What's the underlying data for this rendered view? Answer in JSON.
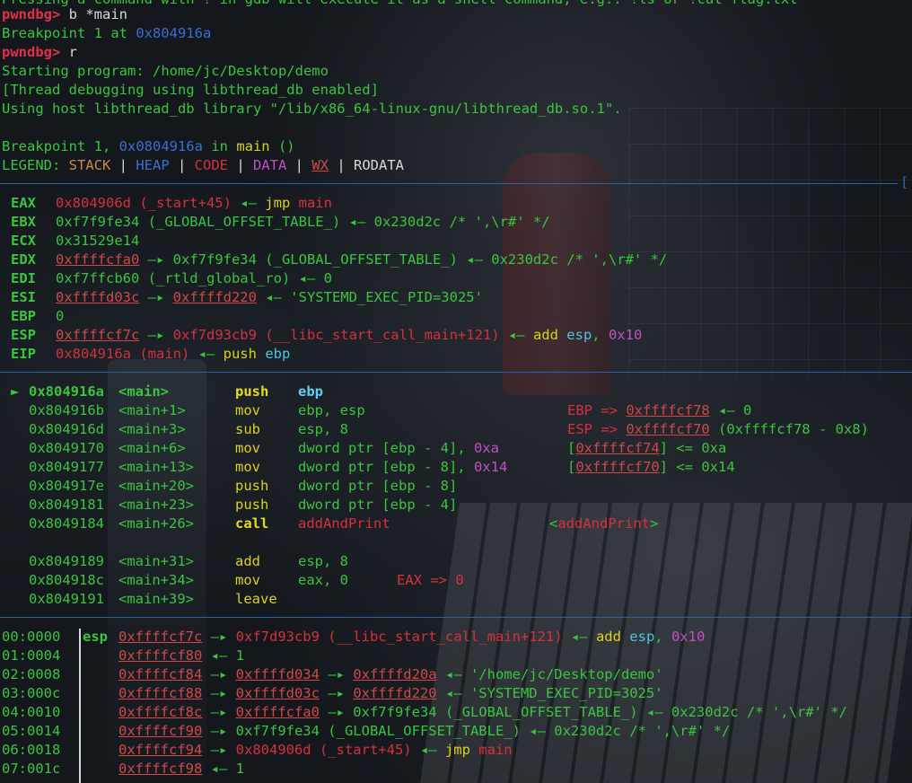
{
  "prompt": "pwndbg>",
  "session": [
    [
      "Pressing a command with ! in gdb will execute it as a shell command, e.g.: !ls or !cat flag.txt"
    ],
    [
      "b *main"
    ],
    [
      "Breakpoint 1 at ",
      "0x804916a"
    ],
    [
      "r"
    ],
    [
      "Starting program: ",
      "/home/jc/Desktop/demo"
    ],
    [
      "[Thread debugging using libthread_db enabled]"
    ],
    [
      "Using host libthread_db library \"/lib/x86_64-linux-gnu/libthread_db.so.1\"."
    ],
    [
      "Breakpoint 1, ",
      "0x0804916a",
      " in ",
      "main",
      " ()"
    ]
  ],
  "legend": {
    "label": "LEGEND:",
    "items": [
      "STACK",
      "HEAP",
      "CODE",
      "DATA",
      "WX",
      "RODATA"
    ]
  },
  "registers_tag": "[",
  "registers": [
    {
      "name": "EAX",
      "parts": [
        [
          "0x804906d (_start+45)",
          "r"
        ],
        [
          " ◂— ",
          "g"
        ],
        [
          "jmp",
          "y"
        ],
        [
          " ",
          "g"
        ],
        [
          "main",
          "r"
        ]
      ]
    },
    {
      "name": "EBX",
      "parts": [
        [
          "0xf7f9fe34 (_GLOBAL_OFFSET_TABLE_)",
          "g"
        ],
        [
          " ◂— 0x230d2c /* ',\\r#' */",
          "g"
        ]
      ]
    },
    {
      "name": "ECX",
      "parts": [
        [
          "0x31529e14",
          "g"
        ]
      ]
    },
    {
      "name": "EDX",
      "parts": [
        [
          "0xffffcfa0",
          "wu"
        ],
        [
          " —▸ 0xf7f9fe34 (_GLOBAL_OFFSET_TABLE_) ◂— 0x230d2c /* ',\\r#' */",
          "g"
        ]
      ]
    },
    {
      "name": "EDI",
      "parts": [
        [
          "0xf7ffcb60 (_rtld_global_ro)",
          "g"
        ],
        [
          " ◂— 0",
          "g"
        ]
      ]
    },
    {
      "name": "ESI",
      "parts": [
        [
          "0xffffd03c",
          "wu"
        ],
        [
          " —▸ ",
          "g"
        ],
        [
          "0xffffd220",
          "wu"
        ],
        [
          " ◂— 'SYSTEMD_EXEC_PID=3025'",
          "g"
        ]
      ]
    },
    {
      "name": "EBP",
      "parts": [
        [
          "0",
          "g"
        ]
      ]
    },
    {
      "name": "ESP",
      "parts": [
        [
          "0xffffcf7c",
          "wu"
        ],
        [
          " —▸ ",
          "g"
        ],
        [
          "0xf7d93cb9 (__libc_start_call_main+121)",
          "r"
        ],
        [
          " ◂— ",
          "g"
        ],
        [
          "add",
          "y"
        ],
        [
          " ",
          "g"
        ],
        [
          "esp",
          "c"
        ],
        [
          ", ",
          "g"
        ],
        [
          "0x10",
          "m"
        ]
      ]
    },
    {
      "name": "EIP",
      "parts": [
        [
          "0x804916a (main)",
          "r"
        ],
        [
          " ◂— ",
          "g"
        ],
        [
          "push",
          "y"
        ],
        [
          " ",
          "g"
        ],
        [
          "ebp",
          "c"
        ]
      ]
    }
  ],
  "disasm": [
    {
      "marker": "►",
      "addr": "0x804916a",
      "sym": "<main>",
      "op": "push",
      "args": [
        [
          "ebp",
          "cb"
        ]
      ],
      "note": [],
      "current": true
    },
    {
      "marker": "",
      "addr": "0x804916b",
      "sym": "<main+1>",
      "op": "mov",
      "args": [
        [
          "ebp, esp",
          "g"
        ]
      ],
      "note": [
        [
          "EBP => ",
          "r"
        ],
        [
          "0xffffcf78",
          "wu"
        ],
        [
          " ◂— 0",
          "g"
        ]
      ]
    },
    {
      "marker": "",
      "addr": "0x804916d",
      "sym": "<main+3>",
      "op": "sub",
      "args": [
        [
          "esp, 8",
          "g"
        ]
      ],
      "note": [
        [
          "ESP => ",
          "r"
        ],
        [
          "0xffffcf70",
          "wu"
        ],
        [
          " (0xffffcf78 - 0x8)",
          "g"
        ]
      ]
    },
    {
      "marker": "",
      "addr": "0x8049170",
      "sym": "<main+6>",
      "op": "mov",
      "args": [
        [
          "dword ptr [ebp - 4], ",
          "g"
        ],
        [
          "0xa",
          "m"
        ]
      ],
      "note": [
        [
          "[",
          "g"
        ],
        [
          "0xffffcf74",
          "wu"
        ],
        [
          "] <= 0xa",
          "g"
        ]
      ]
    },
    {
      "marker": "",
      "addr": "0x8049177",
      "sym": "<main+13>",
      "op": "mov",
      "args": [
        [
          "dword ptr [ebp - 8], ",
          "g"
        ],
        [
          "0x14",
          "m"
        ]
      ],
      "note": [
        [
          "[",
          "g"
        ],
        [
          "0xffffcf70",
          "wu"
        ],
        [
          "] <= 0x14",
          "g"
        ]
      ]
    },
    {
      "marker": "",
      "addr": "0x804917e",
      "sym": "<main+20>",
      "op": "push",
      "args": [
        [
          "dword ptr [ebp - 8]",
          "g"
        ]
      ],
      "note": []
    },
    {
      "marker": "",
      "addr": "0x8049181",
      "sym": "<main+23>",
      "op": "push",
      "args": [
        [
          "dword ptr [ebp - 4]",
          "g"
        ]
      ],
      "note": []
    },
    {
      "marker": "",
      "addr": "0x8049184",
      "sym": "<main+26>",
      "op": "call",
      "args": [
        [
          "addAndPrint",
          "r"
        ]
      ],
      "note": [
        [
          "<",
          "g"
        ],
        [
          "addAndPrint",
          "r"
        ],
        [
          ">",
          "g"
        ]
      ],
      "call": true
    },
    {
      "blank": true
    },
    {
      "marker": "",
      "addr": "0x8049189",
      "sym": "<main+31>",
      "op": "add",
      "args": [
        [
          "esp, 8",
          "g"
        ]
      ],
      "note": []
    },
    {
      "marker": "",
      "addr": "0x804918c",
      "sym": "<main+34>",
      "op": "mov",
      "args": [
        [
          "eax, 0",
          "g"
        ]
      ],
      "note": [
        [
          "EAX => 0",
          "r"
        ]
      ],
      "near": true
    },
    {
      "marker": "",
      "addr": "0x8049191",
      "sym": "<main+39>",
      "op": "leave",
      "args": [],
      "note": []
    }
  ],
  "stack": [
    {
      "off": "00:0000",
      "reg": "esp",
      "parts": [
        [
          "0xffffcf7c",
          "wu"
        ],
        [
          " —▸ ",
          "g"
        ],
        [
          "0xf7d93cb9 (__libc_start_call_main+121)",
          "r"
        ],
        [
          " ◂— ",
          "g"
        ],
        [
          "add",
          "y"
        ],
        [
          " ",
          "g"
        ],
        [
          "esp",
          "c"
        ],
        [
          ", ",
          "g"
        ],
        [
          "0x10",
          "m"
        ]
      ]
    },
    {
      "off": "01:0004",
      "reg": "",
      "parts": [
        [
          "0xffffcf80",
          "wu"
        ],
        [
          " ◂— 1",
          "g"
        ]
      ]
    },
    {
      "off": "02:0008",
      "reg": "",
      "parts": [
        [
          "0xffffcf84",
          "wu"
        ],
        [
          " —▸ ",
          "g"
        ],
        [
          "0xffffd034",
          "wu"
        ],
        [
          " —▸ ",
          "g"
        ],
        [
          "0xffffd20a",
          "wu"
        ],
        [
          " ◂— '/home/jc/Desktop/demo'",
          "g"
        ]
      ]
    },
    {
      "off": "03:000c",
      "reg": "",
      "parts": [
        [
          "0xffffcf88",
          "wu"
        ],
        [
          " —▸ ",
          "g"
        ],
        [
          "0xffffd03c",
          "wu"
        ],
        [
          " —▸ ",
          "g"
        ],
        [
          "0xffffd220",
          "wu"
        ],
        [
          " ◂— 'SYSTEMD_EXEC_PID=3025'",
          "g"
        ]
      ]
    },
    {
      "off": "04:0010",
      "reg": "",
      "parts": [
        [
          "0xffffcf8c",
          "wu"
        ],
        [
          " —▸ ",
          "g"
        ],
        [
          "0xffffcfa0",
          "wu"
        ],
        [
          " —▸ 0xf7f9fe34 (_GLOBAL_OFFSET_TABLE_) ◂— 0x230d2c /* ',\\r#' */",
          "g"
        ]
      ]
    },
    {
      "off": "05:0014",
      "reg": "",
      "parts": [
        [
          "0xffffcf90",
          "wu"
        ],
        [
          " —▸ 0xf7f9fe34 (_GLOBAL_OFFSET_TABLE_) ◂— 0x230d2c /* ',\\r#' */",
          "g"
        ]
      ]
    },
    {
      "off": "06:0018",
      "reg": "",
      "parts": [
        [
          "0xffffcf94",
          "wu"
        ],
        [
          " —▸ ",
          "g"
        ],
        [
          "0x804906d (_start+45)",
          "r"
        ],
        [
          " ◂— ",
          "g"
        ],
        [
          "jmp",
          "y"
        ],
        [
          " ",
          "g"
        ],
        [
          "main",
          "r"
        ]
      ]
    },
    {
      "off": "07:001c",
      "reg": "",
      "parts": [
        [
          "0xffffcf98",
          "wu"
        ],
        [
          " ◂— 1",
          "g"
        ]
      ]
    }
  ],
  "colors": {
    "prompt": "#e0304a",
    "text": "#3bc43f",
    "separator": "#2d62a8",
    "code": "#d6303f",
    "heap": "#3a6fd0",
    "data": "#c24fc4",
    "stack": "#c88a4a"
  }
}
